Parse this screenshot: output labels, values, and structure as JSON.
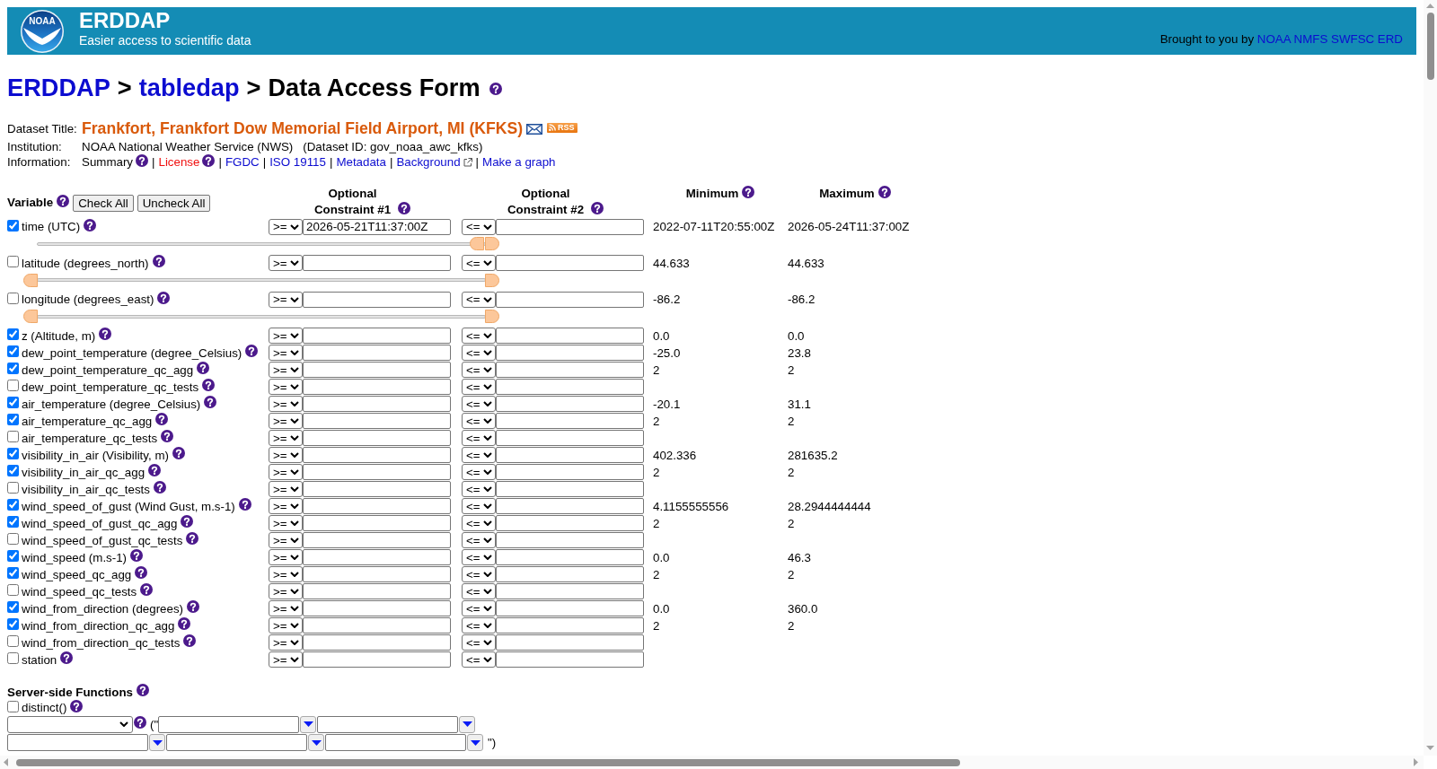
{
  "header": {
    "logo_text": "NOAA",
    "title": "ERDDAP",
    "subtitle": "Easier access to scientific data",
    "credit": "Brought to you by",
    "credit_link": "NOAA NMFS SWFSC ERD"
  },
  "breadcrumb": {
    "items": [
      {
        "kind": "link",
        "label": "ERDDAP"
      },
      {
        "kind": "separator",
        "label": ">"
      },
      {
        "kind": "link",
        "label": "tabledap"
      },
      {
        "kind": "separator",
        "label": ">"
      },
      {
        "kind": "current",
        "label": "Data Access Form"
      }
    ],
    "help": true
  },
  "dataset": {
    "title_label": "Dataset Title:",
    "title": "Frankfort, Frankfort Dow Memorial Field Airport, MI (KFKS)",
    "rss_label": "RSS",
    "institution_label": "Institution:",
    "institution": "NOAA National Weather Service (NWS)",
    "dataset_id": "(Dataset ID: gov_noaa_awc_kfks)",
    "information_label": "Information:",
    "information": [
      {
        "kind": "text",
        "label": "Summary",
        "help": true,
        "external": false
      },
      {
        "kind": "separator",
        "label": "|"
      },
      {
        "kind": "highlighted-link",
        "label": "License",
        "help": true,
        "external": false
      },
      {
        "kind": "separator",
        "label": "|"
      },
      {
        "kind": "link",
        "label": "FGDC",
        "help": false,
        "external": false
      },
      {
        "kind": "separator",
        "label": "|"
      },
      {
        "kind": "link",
        "label": "ISO 19115",
        "help": false,
        "external": false
      },
      {
        "kind": "separator",
        "label": "|"
      },
      {
        "kind": "link",
        "label": "Metadata",
        "help": false,
        "external": false
      },
      {
        "kind": "separator",
        "label": "|"
      },
      {
        "kind": "link",
        "label": "Background",
        "help": false,
        "external": true
      },
      {
        "kind": "separator",
        "label": "|"
      },
      {
        "kind": "link",
        "label": "Make a graph",
        "help": false,
        "external": false
      }
    ]
  },
  "table": {
    "columns": [
      {
        "label": "Variable"
      },
      {
        "label": "Optional Constraint #1"
      },
      {
        "label": "Optional Constraint #2"
      },
      {
        "label": "Minimum"
      },
      {
        "label": "Maximum"
      }
    ],
    "buttons": [
      {
        "label": "Check All"
      },
      {
        "label": "Uncheck All"
      }
    ],
    "variables": [
      {
        "checked": true,
        "label": "time (UTC)",
        "op1": ">=",
        "value1": "2026-05-21T11:37:00Z",
        "op2": "<=",
        "min": "2022-07-11T20:55:00Z",
        "max": "2026-05-24T11:37:00Z",
        "slider": [
          {
            "level": 0.998
          },
          {
            "level": 1
          }
        ]
      },
      {
        "checked": false,
        "label": "latitude (degrees_north)",
        "op1": ">=",
        "op2": "<=",
        "min": "44.633",
        "max": "44.633",
        "slider": [
          {
            "level": 0
          },
          {
            "level": 1
          }
        ]
      },
      {
        "checked": false,
        "label": "longitude (degrees_east)",
        "op1": ">=",
        "op2": "<=",
        "min": "-86.2",
        "max": "-86.2",
        "slider": [
          {
            "level": 0
          },
          {
            "level": 1
          }
        ]
      },
      {
        "checked": true,
        "label": "z (Altitude, m)",
        "op1": ">=",
        "op2": "<=",
        "min": "0.0",
        "max": "0.0"
      },
      {
        "checked": true,
        "label": "dew_point_temperature (degree_Celsius)",
        "op1": ">=",
        "op2": "<=",
        "min": "-25.0",
        "max": "23.8"
      },
      {
        "checked": true,
        "label": "dew_point_temperature_qc_agg",
        "op1": ">=",
        "op2": "<=",
        "min": "2",
        "max": "2"
      },
      {
        "checked": false,
        "label": "dew_point_temperature_qc_tests",
        "op1": ">=",
        "op2": "<="
      },
      {
        "checked": true,
        "label": "air_temperature (degree_Celsius)",
        "op1": ">=",
        "op2": "<=",
        "min": "-20.1",
        "max": "31.1"
      },
      {
        "checked": true,
        "label": "air_temperature_qc_agg",
        "op1": ">=",
        "op2": "<=",
        "min": "2",
        "max": "2"
      },
      {
        "checked": false,
        "label": "air_temperature_qc_tests",
        "op1": ">=",
        "op2": "<="
      },
      {
        "checked": true,
        "label": "visibility_in_air (Visibility, m)",
        "op1": ">=",
        "op2": "<=",
        "min": "402.336",
        "max": "281635.2"
      },
      {
        "checked": true,
        "label": "visibility_in_air_qc_agg",
        "op1": ">=",
        "op2": "<=",
        "min": "2",
        "max": "2"
      },
      {
        "checked": false,
        "label": "visibility_in_air_qc_tests",
        "op1": ">=",
        "op2": "<="
      },
      {
        "checked": true,
        "label": "wind_speed_of_gust (Wind Gust, m.s-1)",
        "op1": ">=",
        "op2": "<=",
        "min": "4.1155555556",
        "max": "28.2944444444"
      },
      {
        "checked": true,
        "label": "wind_speed_of_gust_qc_agg",
        "op1": ">=",
        "op2": "<=",
        "min": "2",
        "max": "2"
      },
      {
        "checked": false,
        "label": "wind_speed_of_gust_qc_tests",
        "op1": ">=",
        "op2": "<="
      },
      {
        "checked": true,
        "label": "wind_speed (m.s-1)",
        "op1": ">=",
        "op2": "<=",
        "min": "0.0",
        "max": "46.3"
      },
      {
        "checked": true,
        "label": "wind_speed_qc_agg",
        "op1": ">=",
        "op2": "<=",
        "min": "2",
        "max": "2"
      },
      {
        "checked": false,
        "label": "wind_speed_qc_tests",
        "op1": ">=",
        "op2": "<="
      },
      {
        "checked": true,
        "label": "wind_from_direction (degrees)",
        "op1": ">=",
        "op2": "<=",
        "min": "0.0",
        "max": "360.0"
      },
      {
        "checked": true,
        "label": "wind_from_direction_qc_agg",
        "op1": ">=",
        "op2": "<=",
        "min": "2",
        "max": "2"
      },
      {
        "checked": false,
        "label": "wind_from_direction_qc_tests",
        "op1": ">=",
        "op2": "<="
      },
      {
        "checked": false,
        "label": "station",
        "op1": ">=",
        "op2": "<="
      }
    ]
  },
  "server_functions": {
    "title": "Server-side Functions",
    "distinct": {
      "checked": false,
      "label": "distinct()"
    },
    "open_text": "(\"",
    "close_text": "\")"
  }
}
